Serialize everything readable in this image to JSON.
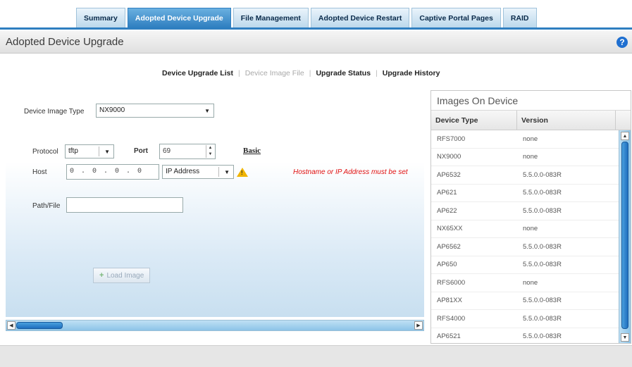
{
  "tabs": [
    {
      "label": "Summary",
      "active": false
    },
    {
      "label": "Adopted Device Upgrade",
      "active": true
    },
    {
      "label": "File Management",
      "active": false
    },
    {
      "label": "Adopted Device Restart",
      "active": false
    },
    {
      "label": "Captive Portal Pages",
      "active": false
    },
    {
      "label": "RAID",
      "active": false
    }
  ],
  "panel": {
    "title": "Adopted Device Upgrade",
    "help_icon": "question-icon"
  },
  "subtabs": [
    {
      "label": "Device Upgrade List",
      "enabled": true
    },
    {
      "label": "Device Image File",
      "enabled": false
    },
    {
      "label": "Upgrade Status",
      "enabled": true
    },
    {
      "label": "Upgrade History",
      "enabled": true
    }
  ],
  "form": {
    "device_image_type_label": "Device Image Type",
    "device_image_type_value": "NX9000",
    "protocol_label": "Protocol",
    "protocol_value": "tftp",
    "port_label": "Port",
    "port_value": "69",
    "basic_link": "Basic",
    "host_label": "Host",
    "host_value": "0 . 0 . 0 . 0",
    "host_type_value": "IP Address",
    "error_message": "Hostname or IP Address must be set",
    "path_label": "Path/File",
    "path_value": "",
    "load_button": "Load Image"
  },
  "images": {
    "title": "Images On Device",
    "columns": [
      "Device Type",
      "Version"
    ],
    "rows": [
      [
        "RFS7000",
        "none"
      ],
      [
        "NX9000",
        "none"
      ],
      [
        "AP6532",
        "5.5.0.0-083R"
      ],
      [
        "AP621",
        "5.5.0.0-083R"
      ],
      [
        "AP622",
        "5.5.0.0-083R"
      ],
      [
        "NX65XX",
        "none"
      ],
      [
        "AP6562",
        "5.5.0.0-083R"
      ],
      [
        "AP650",
        "5.5.0.0-083R"
      ],
      [
        "RFS6000",
        "none"
      ],
      [
        "AP81XX",
        "5.5.0.0-083R"
      ],
      [
        "RFS4000",
        "5.5.0.0-083R"
      ],
      [
        "AP6521",
        "5.5.0.0-083R"
      ]
    ]
  },
  "colors": {
    "accent": "#2f7fc0",
    "error": "#e01010",
    "warning": "#f0b400"
  }
}
